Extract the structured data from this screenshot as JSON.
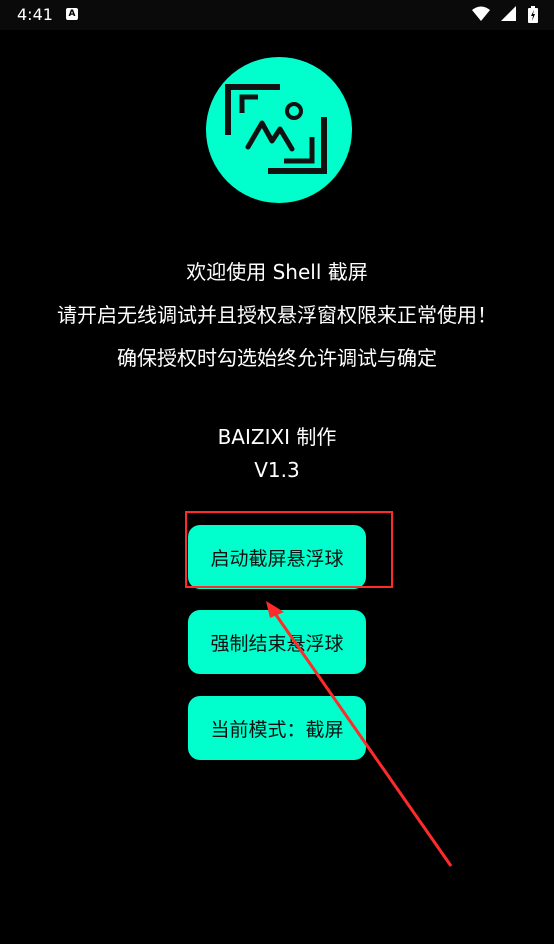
{
  "status_bar": {
    "time": "4:41",
    "notification_badge": "A",
    "icons": [
      "wifi-icon",
      "signal-icon",
      "battery-icon"
    ]
  },
  "app": {
    "logo_icon": "image-frame-icon",
    "accent_color": "#00ffcc",
    "welcome": "欢迎使用 Shell 截屏",
    "instruction": "请开启无线调试并且授权悬浮窗权限来正常使用！",
    "tip": "确保授权时勾选始终允许调试与确定",
    "author": "BAIZIXI 制作",
    "version": "V1.3"
  },
  "buttons": {
    "start_label": "启动截屏悬浮球",
    "stop_label": "强制结束悬浮球",
    "mode_label": "当前模式：截屏"
  },
  "annotation": {
    "highlight_color": "#ff2b2b"
  }
}
